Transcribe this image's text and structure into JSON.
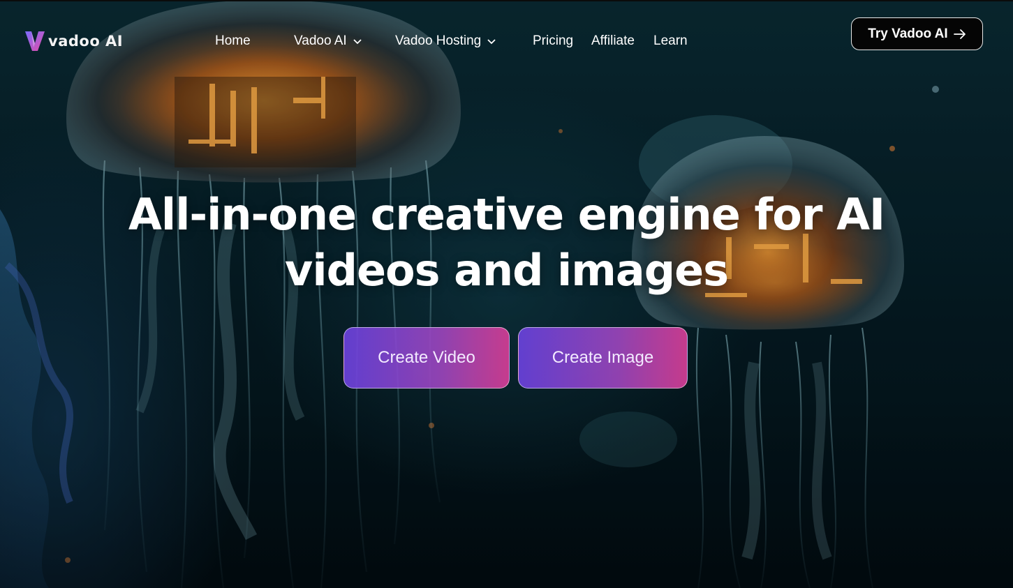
{
  "brand": {
    "name": "vadoo AI"
  },
  "nav": {
    "items": [
      {
        "label": "Home",
        "has_dropdown": false
      },
      {
        "label": "Vadoo AI",
        "has_dropdown": true
      },
      {
        "label": "Vadoo Hosting",
        "has_dropdown": true
      },
      {
        "label": "Pricing",
        "has_dropdown": false
      },
      {
        "label": "Affiliate",
        "has_dropdown": false
      },
      {
        "label": "Learn",
        "has_dropdown": false
      }
    ],
    "cta_label": "Try Vadoo AI",
    "cta_icon": "arrow-right-icon",
    "dropdown_icon": "chevron-down-icon"
  },
  "hero": {
    "headline_line1": "All-in-one creative engine for AI",
    "headline_line2": "videos and images",
    "background": "glowing-jellyfish-underwater-image",
    "buttons": [
      {
        "label": "Create Video"
      },
      {
        "label": "Create Image"
      }
    ]
  },
  "colors": {
    "button_gradient_start": "#6a42dd",
    "button_gradient_end": "#d63e96",
    "cta_background": "#050505",
    "background_dark": "#041218"
  }
}
